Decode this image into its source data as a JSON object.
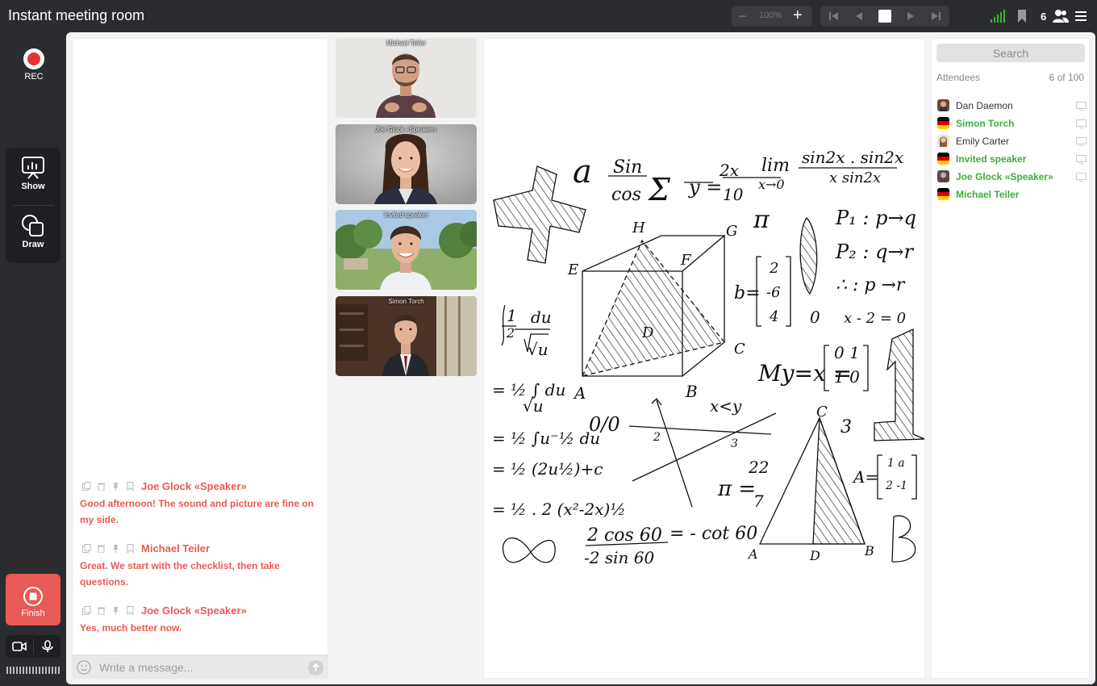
{
  "app": {
    "title": "Instant meeting room"
  },
  "toolbar": {
    "zoom_minus": "−",
    "zoom_value": "100%",
    "zoom_plus": "+",
    "participant_count": "6"
  },
  "left": {
    "rec_label": "REC",
    "show_label": "Show",
    "draw_label": "Draw",
    "finish_label": "Finish"
  },
  "chat": {
    "messages": [
      {
        "author": "Joe Glock «Speaker»",
        "text": "Good afternoon! The sound and picture are fine on my side."
      },
      {
        "author": "Michael Teiler",
        "text": "Great. We start with the checklist, then take questions."
      },
      {
        "author": "Joe Glock «Speaker»",
        "text": "Yes, much better now."
      }
    ],
    "placeholder": "Write a message..."
  },
  "videos": [
    {
      "name": "Michael Teiler"
    },
    {
      "name": "Joe Glock «Speaker»"
    },
    {
      "name": "Invited speaker"
    },
    {
      "name": "Simon Torch"
    }
  ],
  "attendees": {
    "search_placeholder": "Search",
    "label": "Attendees",
    "count": "6 of 100",
    "list": [
      {
        "name": "Dan Daemon",
        "highlight": false,
        "avatar": "photo"
      },
      {
        "name": "Simon Torch",
        "highlight": true,
        "avatar": "flag-de"
      },
      {
        "name": "Emily Carter",
        "highlight": false,
        "avatar": "photo"
      },
      {
        "name": "Invited speaker",
        "highlight": true,
        "avatar": "flag-de"
      },
      {
        "name": "Joe Glock «Speaker»",
        "highlight": true,
        "avatar": "photo"
      },
      {
        "name": "Michael Teiler",
        "highlight": true,
        "avatar": "flag-de"
      }
    ]
  },
  "colors": {
    "accent_red": "#e85a55",
    "accent_green": "#3fae3a",
    "dark_bg": "#2b2c2f"
  }
}
